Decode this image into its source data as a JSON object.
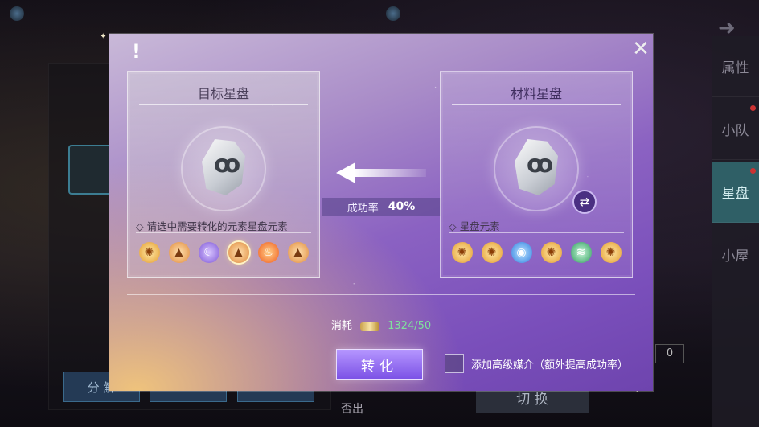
{
  "background": {
    "split_button_label": "分 解",
    "swap_button_label": "切 换",
    "extra_label": "否出",
    "count_box": "0",
    "side_nav": [
      {
        "label": "属性",
        "active": false,
        "dot": false
      },
      {
        "label": "小队",
        "active": false,
        "dot": true
      },
      {
        "label": "星盘",
        "active": true,
        "dot": true
      },
      {
        "label": "小屋",
        "active": false,
        "dot": false
      }
    ]
  },
  "modal": {
    "alert_glyph": "!",
    "close_glyph": "✕",
    "target_panel": {
      "title": "目标星盘",
      "hint": "请选中需要转化的元素星盘元素",
      "elements": [
        {
          "icon": "sun-icon",
          "glyph": "✺",
          "cls": "el-sun",
          "selected": false
        },
        {
          "icon": "rock-icon",
          "glyph": "▲",
          "cls": "el-rock",
          "selected": false
        },
        {
          "icon": "moon-icon",
          "glyph": "☾",
          "cls": "el-moon",
          "selected": false
        },
        {
          "icon": "rock-icon",
          "glyph": "▲",
          "cls": "el-rock",
          "selected": true
        },
        {
          "icon": "fire-icon",
          "glyph": "♨",
          "cls": "el-fire",
          "selected": false
        },
        {
          "icon": "rock-icon",
          "glyph": "▲",
          "cls": "el-rock",
          "selected": false
        }
      ]
    },
    "material_panel": {
      "title": "材料星盘",
      "hint": "星盘元素",
      "swap_glyph": "⇄",
      "elements": [
        {
          "icon": "sun-icon",
          "glyph": "✺",
          "cls": "el-sun"
        },
        {
          "icon": "sun-icon",
          "glyph": "✺",
          "cls": "el-sun"
        },
        {
          "icon": "water-icon",
          "glyph": "◉",
          "cls": "el-water"
        },
        {
          "icon": "sun-icon",
          "glyph": "✺",
          "cls": "el-sun"
        },
        {
          "icon": "wind-icon",
          "glyph": "≋",
          "cls": "el-wind"
        },
        {
          "icon": "sun-icon",
          "glyph": "✺",
          "cls": "el-sun"
        }
      ]
    },
    "success_rate": {
      "label": "成功率",
      "value": "40%"
    },
    "cost": {
      "label": "消耗",
      "amount": "1324/50"
    },
    "convert_button_label": "转化",
    "medium_label": "添加高级媒介（额外提高成功率）",
    "medium_checked": false
  }
}
